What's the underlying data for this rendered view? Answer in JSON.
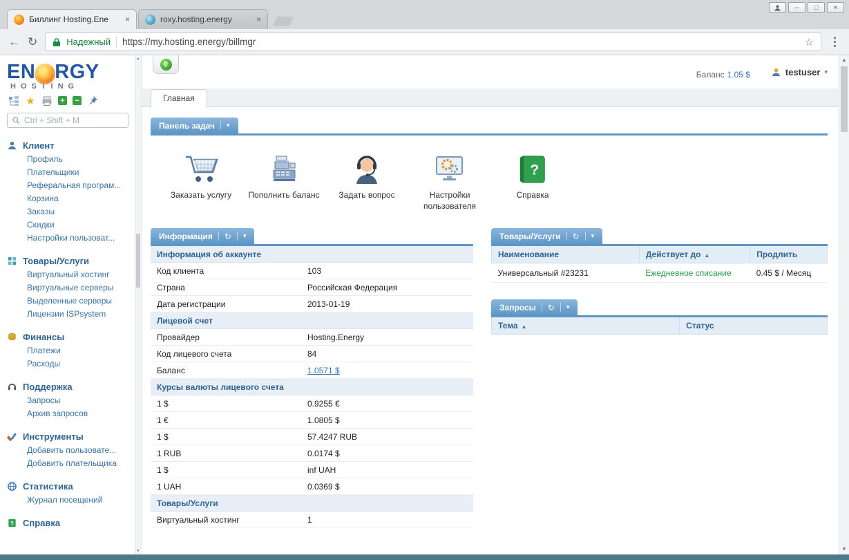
{
  "glyphs": {
    "close": "×",
    "back": "←",
    "reload": "↻",
    "refresh": "↻",
    "star_outline": "☆",
    "star_filled": "★",
    "menu_dots": "⋮",
    "dropdown": "▾",
    "sort_asc": "▲",
    "minimize": "–",
    "maximize": "□",
    "plus": "+",
    "minus": "−",
    "question": "?",
    "scroll_up": "▲",
    "scroll_down": "▼"
  },
  "browser": {
    "tabs": [
      {
        "title": "Биллинг Hosting.Ene"
      },
      {
        "title": "roxy.hosting.energy"
      }
    ],
    "security_label": "Надежный",
    "url": "https://my.hosting.energy/billmgr"
  },
  "logo": {
    "part1": "EN",
    "part2": "RGY",
    "sub": "HOSTING"
  },
  "sidebar": {
    "search_placeholder": "Ctrl + Shift + M",
    "sections": [
      {
        "title": "Клиент",
        "items": [
          "Профиль",
          "Плательщики",
          "Реферальная програм...",
          "Корзина",
          "Заказы",
          "Скидки",
          "Настройки пользоват..."
        ]
      },
      {
        "title": "Товары/Услуги",
        "items": [
          "Виртуальный хостинг",
          "Виртуальные серверы",
          "Выделенные серверы",
          "Лицензии ISPsystem"
        ]
      },
      {
        "title": "Финансы",
        "items": [
          "Платежи",
          "Расходы"
        ]
      },
      {
        "title": "Поддержка",
        "items": [
          "Запросы",
          "Архив запросов"
        ]
      },
      {
        "title": "Инструменты",
        "items": [
          "Добавить пользовате...",
          "Добавить плательщика"
        ]
      },
      {
        "title": "Статистика",
        "items": [
          "Журнал посещений"
        ]
      },
      {
        "title": "Справка",
        "items": []
      }
    ]
  },
  "topbar": {
    "balance_label": "Баланс",
    "balance_value": "1.05 $",
    "user": "testuser",
    "notification_count": "0"
  },
  "nav": {
    "home_tab": "Главная"
  },
  "taskbar": {
    "title": "Панель задач",
    "shortcuts": [
      "Заказать услугу",
      "Пополнить баланс",
      "Задать вопрос",
      "Настройки пользователя",
      "Справка"
    ]
  },
  "info_panel": {
    "title": "Информация",
    "groups": [
      {
        "header": "Информация об аккаунте",
        "rows": [
          {
            "label": "Код клиента",
            "value": "103"
          },
          {
            "label": "Страна",
            "value": "Российская Федерация"
          },
          {
            "label": "Дата регистрации",
            "value": "2013-01-19"
          }
        ]
      },
      {
        "header": "Лицевой счет",
        "rows": [
          {
            "label": "Провайдер",
            "value": "Hosting.Energy"
          },
          {
            "label": "Код лицевого счета",
            "value": "84"
          },
          {
            "label": "Баланс",
            "value": "1.0571 $"
          }
        ]
      },
      {
        "header": "Курсы валюты лицевого счета",
        "rows": [
          {
            "label": "1 $",
            "value": "0.9255 €"
          },
          {
            "label": "1 €",
            "value": "1.0805 $"
          },
          {
            "label": "1 $",
            "value": "57.4247 RUB"
          },
          {
            "label": "1 RUB",
            "value": "0.0174 $"
          },
          {
            "label": "1 $",
            "value": "inf UAH"
          },
          {
            "label": "1 UAH",
            "value": "0.0369 $"
          }
        ]
      },
      {
        "header": "Товары/Услуги",
        "rows": [
          {
            "label": "Виртуальный хостинг",
            "value": "1"
          }
        ]
      }
    ]
  },
  "products_panel": {
    "title": "Товары/Услуги",
    "columns": [
      "Наименование",
      "Действует до",
      "Продлить"
    ],
    "rows": [
      {
        "name": "Универсальный #23231",
        "valid_until": "Ежедневное списание",
        "renew": "0.45 $ / Месяц"
      }
    ]
  },
  "requests_panel": {
    "title": "Запросы",
    "columns": [
      "Тема",
      "Статус"
    ]
  }
}
